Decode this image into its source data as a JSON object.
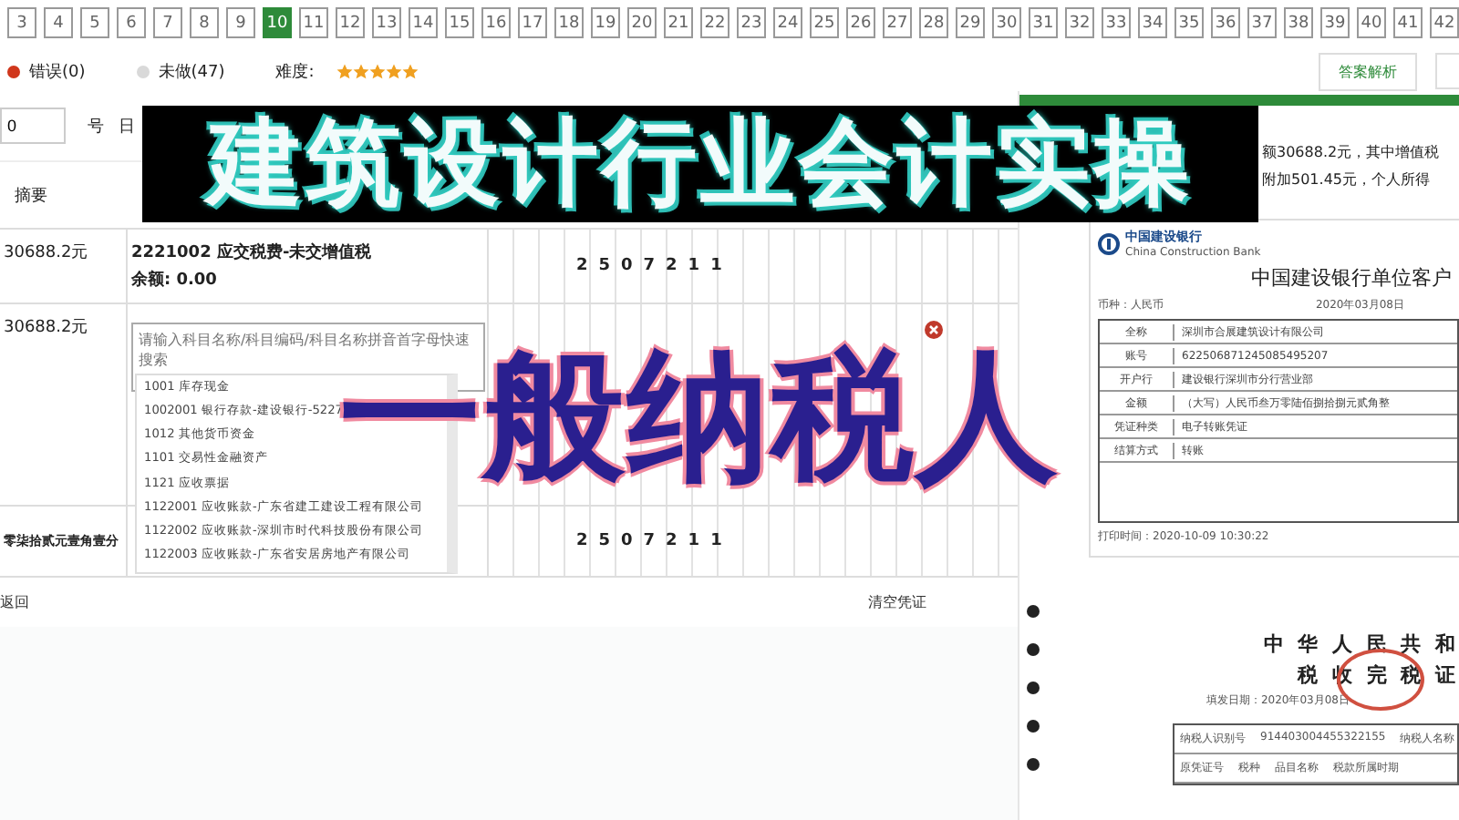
{
  "pager": {
    "pages": [
      {
        "label": "3",
        "selected": false
      },
      {
        "label": "4",
        "selected": false
      },
      {
        "label": "5",
        "selected": false
      },
      {
        "label": "6",
        "selected": false
      },
      {
        "label": "7",
        "selected": false
      },
      {
        "label": "8",
        "selected": false
      },
      {
        "label": "9",
        "selected": false
      },
      {
        "label": "10",
        "selected": true
      },
      {
        "label": "11",
        "selected": false
      },
      {
        "label": "12",
        "selected": false
      },
      {
        "label": "13",
        "selected": false
      },
      {
        "label": "14",
        "selected": false
      },
      {
        "label": "15",
        "selected": false
      },
      {
        "label": "16",
        "selected": false
      },
      {
        "label": "17",
        "selected": false
      },
      {
        "label": "18",
        "selected": false
      },
      {
        "label": "19",
        "selected": false
      },
      {
        "label": "20",
        "selected": false
      },
      {
        "label": "21",
        "selected": false
      },
      {
        "label": "22",
        "selected": false
      },
      {
        "label": "23",
        "selected": false
      },
      {
        "label": "24",
        "selected": false
      },
      {
        "label": "25",
        "selected": false
      },
      {
        "label": "26",
        "selected": false
      },
      {
        "label": "27",
        "selected": false
      },
      {
        "label": "28",
        "selected": false
      },
      {
        "label": "29",
        "selected": false
      },
      {
        "label": "30",
        "selected": false
      },
      {
        "label": "31",
        "selected": false
      },
      {
        "label": "32",
        "selected": false
      },
      {
        "label": "33",
        "selected": false
      },
      {
        "label": "34",
        "selected": false
      },
      {
        "label": "35",
        "selected": false
      },
      {
        "label": "36",
        "selected": false
      },
      {
        "label": "37",
        "selected": false
      },
      {
        "label": "38",
        "selected": false
      },
      {
        "label": "39",
        "selected": false
      },
      {
        "label": "40",
        "selected": false
      },
      {
        "label": "41",
        "selected": false
      },
      {
        "label": "42",
        "selected": false
      }
    ]
  },
  "status": {
    "items": [
      {
        "label": "错误(0)",
        "color": "#d0371c"
      },
      {
        "label": "未做(47)",
        "color": "#d9d9d9"
      }
    ],
    "difficulty_label": "难度:",
    "stars": 5,
    "buttons": [
      "答案解析"
    ]
  },
  "voucher": {
    "number_value": "0",
    "number_label": "号",
    "date_label": "日",
    "summary_heading": "摘要",
    "rows": [
      {
        "summary": "30688.2元",
        "account": "2221002 应交税费-未交增值税",
        "balance": "余额: 0.00",
        "amount": "2507211"
      },
      {
        "summary": "30688.2元",
        "placeholder": "请输入科目名称/科目编码/科目名称拼音首字母快速搜索"
      }
    ],
    "dropdown": [
      "1001 库存现金",
      "1002001 银行存款-建设银行-5227",
      "1012 其他货币资金",
      "1101 交易性金融资产",
      "1121 应收票据",
      "1122001 应收账款-广东省建工建设工程有限公司",
      "1122002 应收账款-深圳市时代科技股份有限公司",
      "1122003 应收账款-广东省安居房地产有限公司"
    ],
    "total_words": "零柒拾贰元壹角壹分",
    "total_amount": "2507211",
    "back_link": "返回",
    "clear_link": "清空凭证"
  },
  "document": {
    "note_lines": [
      "额30688.2元，其中增值税",
      "附加501.45元，个人所得"
    ],
    "bank": {
      "name": "中国建设银行",
      "name_en": "China Construction Bank",
      "title": "中国建设银行单位客户",
      "currency": "币种：人民币",
      "date": "2020年03月08日",
      "rows": [
        {
          "label": "全称",
          "value": "深圳市合展建筑设计有限公司"
        },
        {
          "label": "账号",
          "value": "622506871245085495207"
        },
        {
          "label": "开户行",
          "value": "建设银行深圳市分行营业部"
        },
        {
          "label": "金额",
          "value": "（大写）人民币叁万零陆佰捌拾捌元贰角整"
        },
        {
          "label": "凭证种类",
          "value": "电子转账凭证"
        },
        {
          "label": "结算方式",
          "value": "转账"
        }
      ],
      "print_time": "打印时间：2020-10-09 10:30:22"
    },
    "tax": {
      "title_1": "中 华 人 民 共 和",
      "title_2": "税 收 完 税 证",
      "date": "填发日期：2020年03月08日",
      "headers": [
        "纳税人识别号",
        "914403004455322155",
        "纳税人名称"
      ],
      "headers_2": [
        "原凭证号",
        "税种",
        "品目名称",
        "税款所属时期"
      ]
    }
  },
  "overlay": {
    "title": "建筑设计行业会计实操",
    "subtitle": "一般纳税人"
  }
}
